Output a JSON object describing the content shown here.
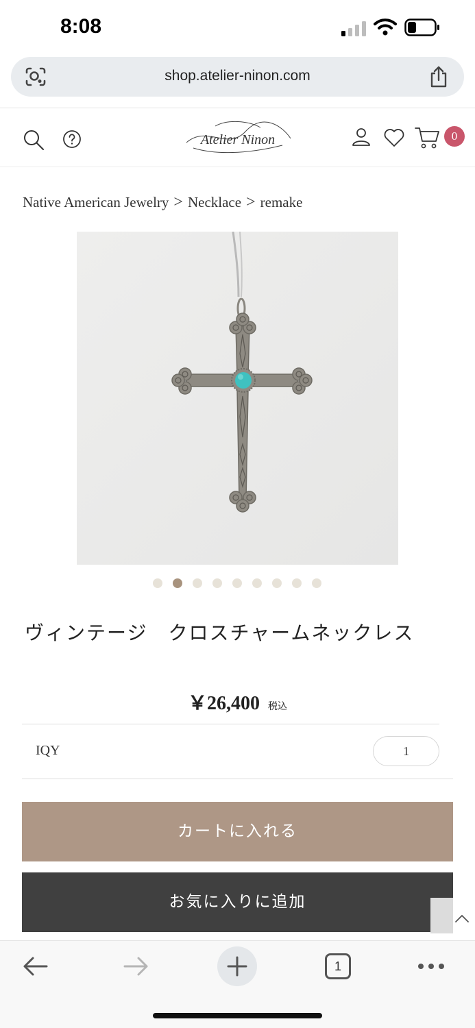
{
  "status_bar": {
    "time": "8:08"
  },
  "browser": {
    "url": "shop.atelier-ninon.com"
  },
  "header": {
    "logo_text": "Atelier Ninon",
    "cart_count": "0"
  },
  "breadcrumb": {
    "items": [
      "Native American Jewelry",
      "Necklace",
      "remake"
    ],
    "separator": ">"
  },
  "gallery": {
    "image_count": 9,
    "active_index": 1
  },
  "product": {
    "title": "ヴィンテージ　クロスチャームネックレス",
    "price": "￥26,400",
    "tax_note": "税込",
    "quantity_label": "IQY",
    "quantity_value": "1"
  },
  "actions": {
    "add_to_cart": "カートに入れる",
    "add_to_favorites": "お気に入りに追加"
  },
  "toolbar": {
    "tab_count": "1"
  },
  "colors": {
    "cart_button": "#ae9786",
    "favorites_button": "#404040",
    "cart_badge": "#c9566b",
    "active_dot": "#a8937e",
    "turquoise": "#3fc1c0"
  }
}
